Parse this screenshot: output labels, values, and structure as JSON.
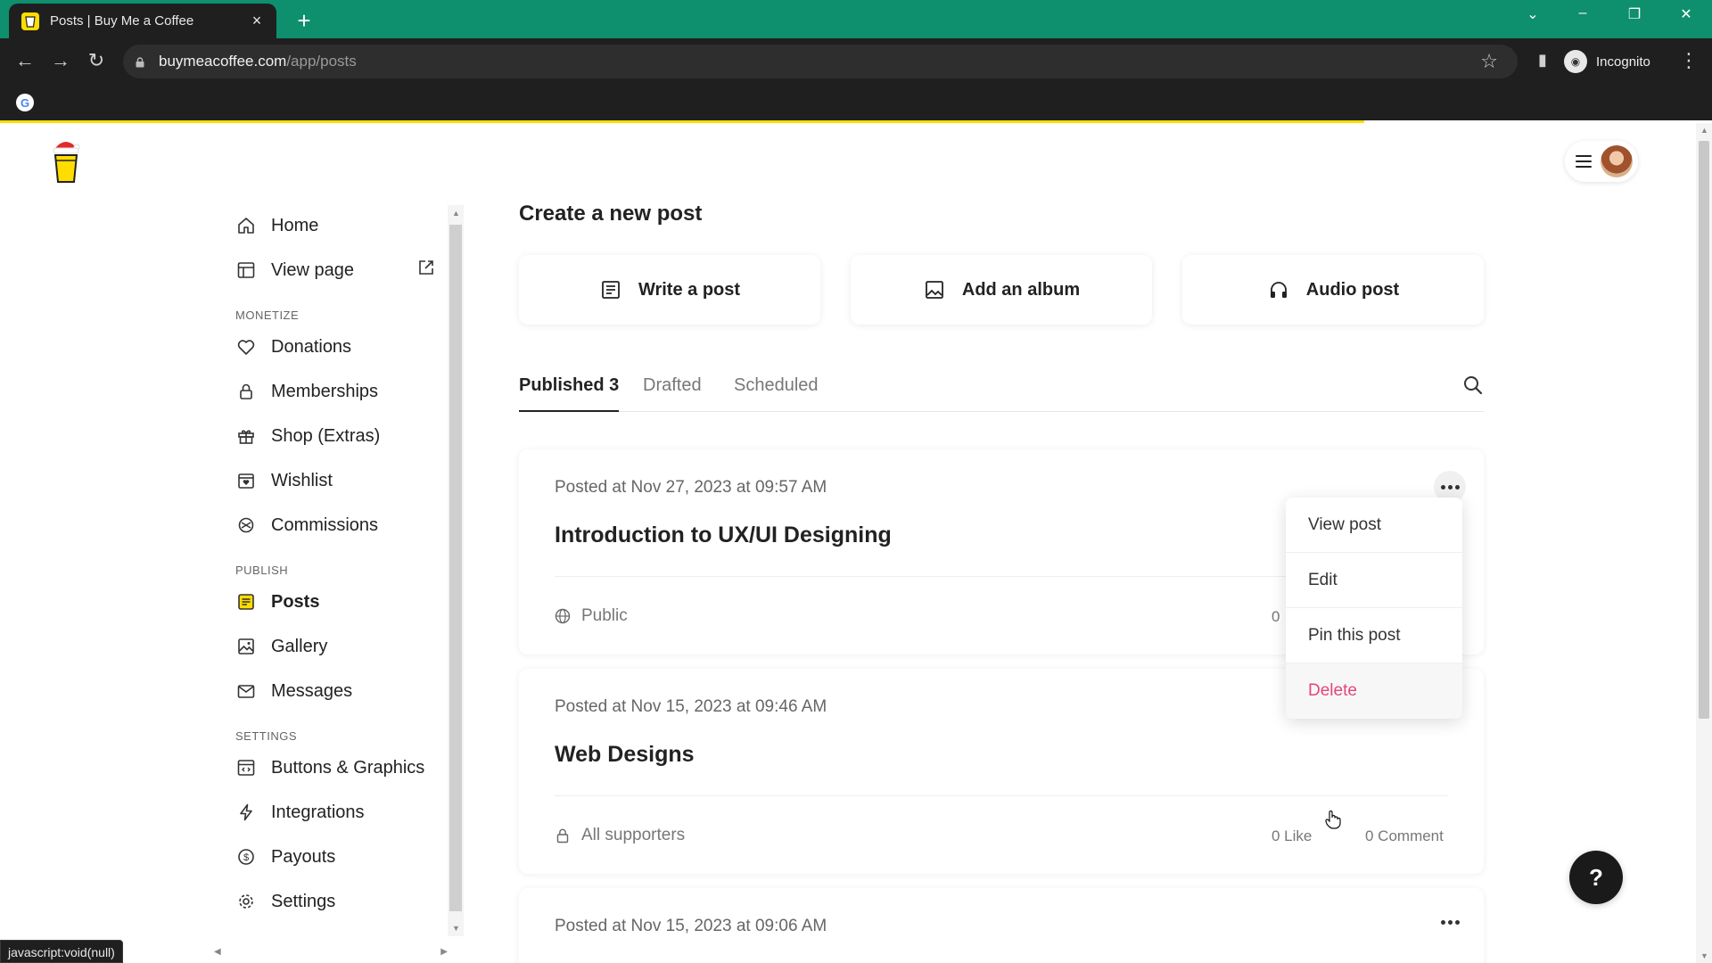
{
  "browser": {
    "tab_title": "Posts | Buy Me a Coffee",
    "url_host": "buymeacoffee.com",
    "url_path": "/app/posts",
    "profile_label": "Incognito",
    "status_text": "javascript:void(null)"
  },
  "sidebar": {
    "top": [
      {
        "label": "Home",
        "icon": "home-icon"
      },
      {
        "label": "View page",
        "icon": "layout-icon"
      }
    ],
    "monetize_heading": "MONETIZE",
    "monetize": [
      {
        "label": "Donations",
        "icon": "heart-icon"
      },
      {
        "label": "Memberships",
        "icon": "lock-icon"
      },
      {
        "label": "Shop (Extras)",
        "icon": "gift-icon"
      },
      {
        "label": "Wishlist",
        "icon": "wishlist-icon"
      },
      {
        "label": "Commissions",
        "icon": "commissions-icon"
      }
    ],
    "publish_heading": "PUBLISH",
    "publish": [
      {
        "label": "Posts",
        "icon": "posts-icon"
      },
      {
        "label": "Gallery",
        "icon": "image-icon"
      },
      {
        "label": "Messages",
        "icon": "mail-icon"
      }
    ],
    "settings_heading": "SETTINGS",
    "settings": [
      {
        "label": "Buttons & Graphics",
        "icon": "code-window-icon"
      },
      {
        "label": "Integrations",
        "icon": "bolt-icon"
      },
      {
        "label": "Payouts",
        "icon": "dollar-icon"
      },
      {
        "label": "Settings",
        "icon": "gear-icon"
      }
    ]
  },
  "create": {
    "title": "Create a new post",
    "write": "Write a post",
    "album": "Add an album",
    "audio": "Audio post"
  },
  "tabs": {
    "published": "Published 3",
    "drafted": "Drafted",
    "scheduled": "Scheduled"
  },
  "posts": [
    {
      "date": "Posted at Nov 27, 2023 at 09:57 AM",
      "title": "Introduction to UX/UI Designing",
      "visibility": "Public",
      "likes": "0"
    },
    {
      "date": "Posted at Nov 15, 2023 at 09:46 AM",
      "title": "Web Designs",
      "visibility": "All supporters",
      "likes": "0 Like",
      "comments": "0 Comment"
    },
    {
      "date": "Posted at Nov 15, 2023 at 09:06 AM"
    }
  ],
  "dropdown": {
    "view": "View post",
    "edit": "Edit",
    "pin": "Pin this post",
    "delete": "Delete"
  },
  "help_label": "?",
  "colors": {
    "brand_yellow": "#ffdd00",
    "tabbar_green": "#0e8f6e",
    "danger": "#e2477b"
  }
}
